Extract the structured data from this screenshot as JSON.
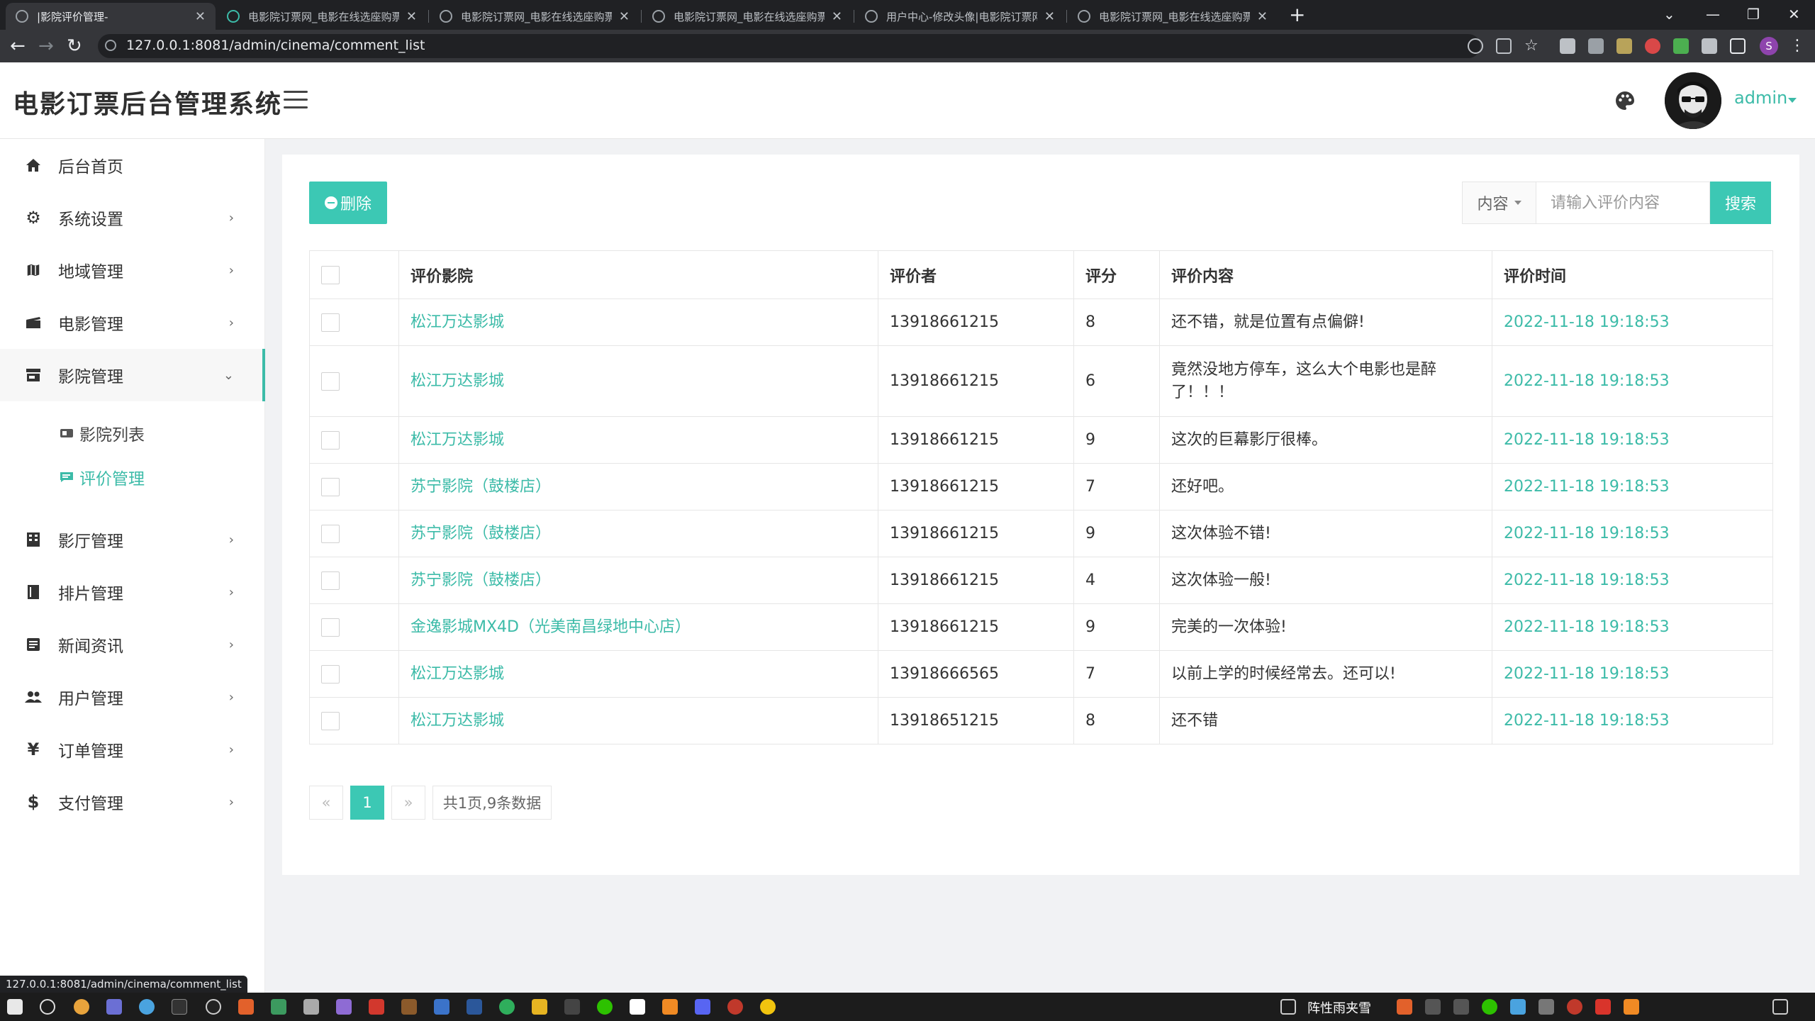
{
  "browser": {
    "tabs": [
      {
        "title": "|影院评价管理-",
        "active": true
      },
      {
        "title": "电影院订票网_电影在线选座购票",
        "active": false
      },
      {
        "title": "电影院订票网_电影在线选座购票",
        "active": false
      },
      {
        "title": "电影院订票网_电影在线选座购票",
        "active": false
      },
      {
        "title": "用户中心-修改头像|电影院订票网",
        "active": false
      },
      {
        "title": "电影院订票网_电影在线选座购票",
        "active": false
      }
    ],
    "url": "127.0.0.1:8081/admin/cinema/comment_list",
    "status_url": "127.0.0.1:8081/admin/cinema/comment_list",
    "profile_initial": "S"
  },
  "header": {
    "brand": "电影订票后台管理系统",
    "user_name": "admin"
  },
  "sidebar": {
    "items": [
      {
        "label": "后台首页",
        "icon": "home-icon",
        "has_children": false
      },
      {
        "label": "系统设置",
        "icon": "gear-icon",
        "has_children": true
      },
      {
        "label": "地域管理",
        "icon": "map-icon",
        "has_children": true
      },
      {
        "label": "电影管理",
        "icon": "film-icon",
        "has_children": true
      },
      {
        "label": "影院管理",
        "icon": "store-icon",
        "has_children": true,
        "open": true
      },
      {
        "label": "影厅管理",
        "icon": "building-icon",
        "has_children": true
      },
      {
        "label": "排片管理",
        "icon": "schedule-icon",
        "has_children": true
      },
      {
        "label": "新闻资讯",
        "icon": "news-icon",
        "has_children": true
      },
      {
        "label": "用户管理",
        "icon": "users-icon",
        "has_children": true
      },
      {
        "label": "订单管理",
        "icon": "yen-icon",
        "has_children": true
      },
      {
        "label": "支付管理",
        "icon": "dollar-icon",
        "has_children": true
      }
    ],
    "sub_items": [
      {
        "label": "影院列表",
        "active": false
      },
      {
        "label": "评价管理",
        "active": true
      }
    ]
  },
  "toolbar": {
    "delete_label": "删除",
    "search_field": "内容",
    "search_placeholder": "请输入评价内容",
    "search_label": "搜索"
  },
  "table": {
    "headers": [
      "评价影院",
      "评价者",
      "评分",
      "评价内容",
      "评价时间"
    ],
    "rows": [
      {
        "cinema": "松江万达影城",
        "user": "13918661215",
        "score": "8",
        "content": "还不错，就是位置有点偏僻!",
        "time": "2022-11-18 19:18:53"
      },
      {
        "cinema": "松江万达影城",
        "user": "13918661215",
        "score": "6",
        "content": "竟然没地方停车，这么大个电影也是醉了！！！",
        "time": "2022-11-18 19:18:53"
      },
      {
        "cinema": "松江万达影城",
        "user": "13918661215",
        "score": "9",
        "content": "这次的巨幕影厅很棒。",
        "time": "2022-11-18 19:18:53"
      },
      {
        "cinema": "苏宁影院（鼓楼店）",
        "user": "13918661215",
        "score": "7",
        "content": "还好吧。",
        "time": "2022-11-18 19:18:53"
      },
      {
        "cinema": "苏宁影院（鼓楼店）",
        "user": "13918661215",
        "score": "9",
        "content": "这次体验不错!",
        "time": "2022-11-18 19:18:53"
      },
      {
        "cinema": "苏宁影院（鼓楼店）",
        "user": "13918661215",
        "score": "4",
        "content": "这次体验一般!",
        "time": "2022-11-18 19:18:53"
      },
      {
        "cinema": "金逸影城MX4D（光美南昌绿地中心店）",
        "user": "13918661215",
        "score": "9",
        "content": "完美的一次体验!",
        "time": "2022-11-18 19:18:53"
      },
      {
        "cinema": "松江万达影城",
        "user": "13918666565",
        "score": "7",
        "content": "以前上学的时候经常去。还可以!",
        "time": "2022-11-18 19:18:53"
      },
      {
        "cinema": "松江万达影城",
        "user": "13918651215",
        "score": "8",
        "content": "还不错",
        "time": "2022-11-18 19:18:53"
      }
    ]
  },
  "pagination": {
    "prev": "«",
    "current": "1",
    "next": "»",
    "summary": "共1页,9条数据"
  },
  "taskbar": {
    "weather": "阵性雨夹雪"
  },
  "colors": {
    "accent": "#3cc8b4",
    "link": "#3cbba8"
  }
}
